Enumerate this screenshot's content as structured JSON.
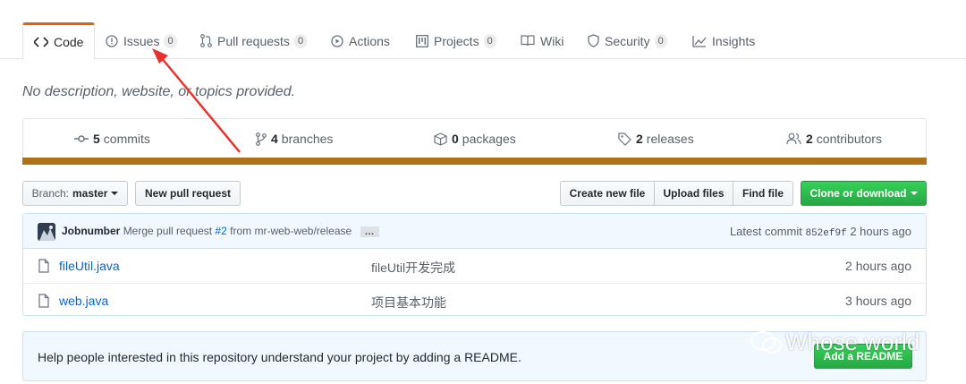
{
  "tabs": [
    {
      "label": "Code",
      "icon": "code-icon",
      "selected": true
    },
    {
      "label": "Issues",
      "icon": "issue-opened-icon",
      "count": "0"
    },
    {
      "label": "Pull requests",
      "icon": "git-pull-request-icon",
      "count": "0"
    },
    {
      "label": "Actions",
      "icon": "play-icon"
    },
    {
      "label": "Projects",
      "icon": "project-icon",
      "count": "0"
    },
    {
      "label": "Wiki",
      "icon": "book-icon"
    },
    {
      "label": "Security",
      "icon": "shield-icon",
      "count": "0"
    },
    {
      "label": "Insights",
      "icon": "graph-icon"
    }
  ],
  "description": "No description, website, or topics provided.",
  "summary": {
    "commits": {
      "count": "5",
      "label": "commits"
    },
    "branches": {
      "count": "4",
      "label": "branches"
    },
    "packages": {
      "count": "0",
      "label": "packages"
    },
    "releases": {
      "count": "2",
      "label": "releases"
    },
    "contributors": {
      "count": "2",
      "label": "contributors"
    },
    "language_color": "#b07219"
  },
  "toolbar": {
    "branch_prefix": "Branch:",
    "branch_name": "master",
    "new_pull_request": "New pull request",
    "create_new_file": "Create new file",
    "upload_files": "Upload files",
    "find_file": "Find file",
    "clone_or_download": "Clone or download"
  },
  "latest_commit": {
    "author": "Jobnumber",
    "message_prefix": "Merge pull request",
    "pr_link": "#2",
    "message_suffix": "from mr-web-web/release",
    "ellipsis": "…",
    "label": "Latest commit",
    "sha": "852ef9f",
    "age": "2 hours ago"
  },
  "files": [
    {
      "name": "fileUtil.java",
      "message": "fileUtil开发完成",
      "age": "2 hours ago"
    },
    {
      "name": "web.java",
      "message": "项目基本功能",
      "age": "3 hours ago"
    }
  ],
  "readme": {
    "text": "Help people interested in this repository understand your project by adding a README.",
    "button": "Add a README"
  },
  "watermark": "Whose world",
  "colors": {
    "accent": "#e36209",
    "link": "#0366d6",
    "green": "#28a745",
    "arrow": "#e8322e"
  }
}
